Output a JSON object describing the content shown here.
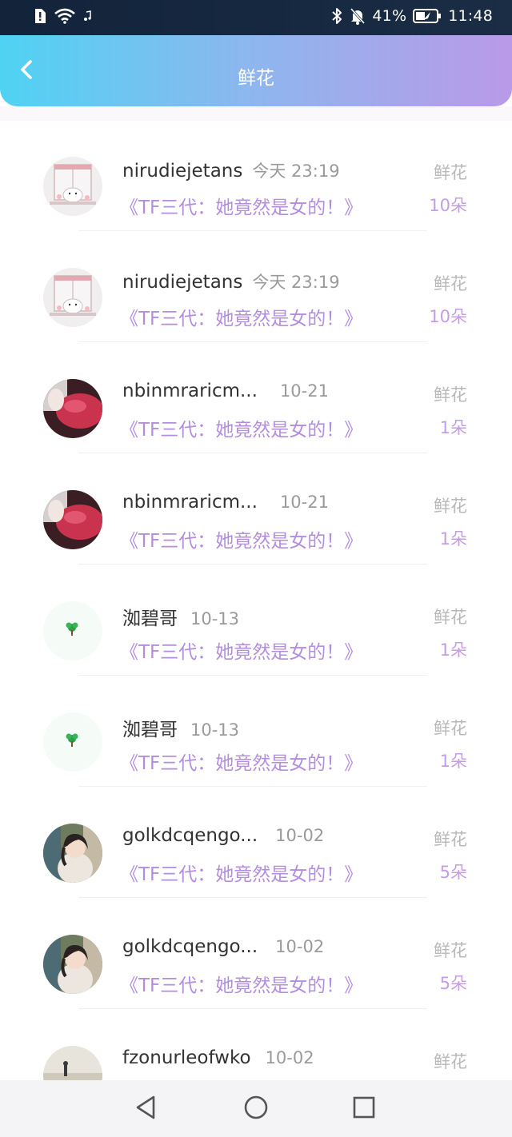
{
  "status_bar": {
    "battery": "41%",
    "time": "11:48",
    "icons": [
      "sim-alert-icon",
      "wifi-icon",
      "music-note-icon",
      "bluetooth-icon",
      "bell-off-icon",
      "battery-icon"
    ]
  },
  "header": {
    "title": "鲜花",
    "back_icon": "chevron-left-icon",
    "gradient": [
      "#4fd3f3",
      "#b99ae8"
    ]
  },
  "items": [
    {
      "name": "nirudiejetans",
      "date": "今天 23:19",
      "book": "《TF三代：她竟然是女的！》",
      "type": "鲜花",
      "count": "10朵",
      "avatar": "cartoon-window"
    },
    {
      "name": "nirudiejetans",
      "date": "今天 23:19",
      "book": "《TF三代：她竟然是女的！》",
      "type": "鲜花",
      "count": "10朵",
      "avatar": "cartoon-window"
    },
    {
      "name": "nbinmraricm...",
      "date": "10-21",
      "book": "《TF三代：她竟然是女的！》",
      "type": "鲜花",
      "count": "1朵",
      "avatar": "red-heart-pillow"
    },
    {
      "name": "nbinmraricm...",
      "date": "10-21",
      "book": "《TF三代：她竟然是女的！》",
      "type": "鲜花",
      "count": "1朵",
      "avatar": "red-heart-pillow"
    },
    {
      "name": "洳碧哥",
      "date": "10-13",
      "book": "《TF三代：她竟然是女的！》",
      "type": "鲜花",
      "count": "1朵",
      "avatar": "tiny-tree"
    },
    {
      "name": "洳碧哥",
      "date": "10-13",
      "book": "《TF三代：她竟然是女的！》",
      "type": "鲜花",
      "count": "1朵",
      "avatar": "tiny-tree"
    },
    {
      "name": "golkdcqengo...",
      "date": "10-02",
      "book": "《TF三代：她竟然是女的！》",
      "type": "鲜花",
      "count": "5朵",
      "avatar": "girl-photo"
    },
    {
      "name": "golkdcqengo...",
      "date": "10-02",
      "book": "《TF三代：她竟然是女的！》",
      "type": "鲜花",
      "count": "5朵",
      "avatar": "girl-photo"
    },
    {
      "name": "fzonurleofwko",
      "date": "10-02",
      "book": "",
      "type": "鲜花",
      "count": "",
      "avatar": "beach-figure"
    }
  ],
  "nav_bar": {
    "buttons": [
      "back-triangle-icon",
      "home-circle-icon",
      "recents-square-icon"
    ]
  },
  "colors": {
    "accent_purple": "#b48ede",
    "count_purple": "#c39ee6",
    "muted_gray": "#b8b8b8"
  }
}
